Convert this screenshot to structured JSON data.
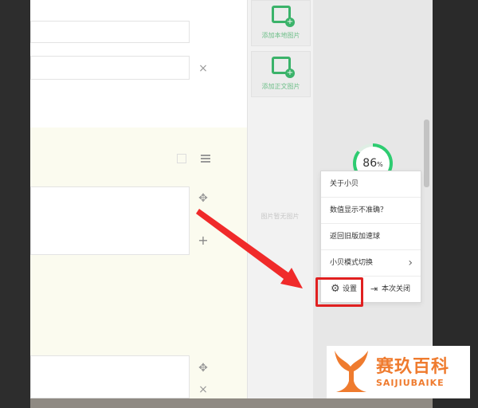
{
  "image_panel": {
    "local_image_button": "添加本地图片",
    "other_image_button": "添加正文图片",
    "no_image_text": "图片暂无图片"
  },
  "speed_widget": {
    "value": "86",
    "unit": "%"
  },
  "context_menu": {
    "items": [
      {
        "label": "关于小贝"
      },
      {
        "label": "数值显示不准确？"
      },
      {
        "label": "返回旧版加速球"
      },
      {
        "label": "小贝模式切换"
      }
    ],
    "settings_label": "设置",
    "close_label": "本次关闭"
  },
  "editor": {
    "remove_symbol": "×",
    "move_symbol": "✥",
    "add_symbol": "+"
  },
  "watermark": {
    "name_cn": "赛玖百科",
    "name_en": "SAIJIUBAIKE"
  },
  "colors": {
    "accent_green": "#2ecc71",
    "highlight_red": "#e02020",
    "brand_orange": "#ef7b2e"
  }
}
